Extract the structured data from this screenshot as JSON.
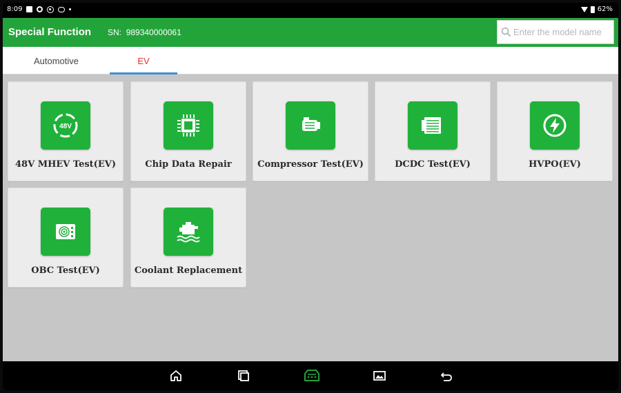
{
  "status_bar": {
    "time": "8:09",
    "battery": "62%"
  },
  "header": {
    "title": "Special Function",
    "sn_label": "SN:",
    "sn_value": "989340000061",
    "search_placeholder": "Enter the model name"
  },
  "tabs": [
    {
      "label": "Automotive",
      "active": false
    },
    {
      "label": "EV",
      "active": true
    }
  ],
  "functions": [
    {
      "label": "48V MHEV Test(EV)",
      "icon": "48v-icon"
    },
    {
      "label": "Chip Data Repair",
      "icon": "chip-icon"
    },
    {
      "label": "Compressor Test(EV)",
      "icon": "compressor-icon"
    },
    {
      "label": "DCDC Test(EV)",
      "icon": "dcdc-icon"
    },
    {
      "label": "HVPO(EV)",
      "icon": "hvpo-icon"
    },
    {
      "label": "OBC Test(EV)",
      "icon": "obc-icon"
    },
    {
      "label": "Coolant Replacement",
      "icon": "coolant-icon"
    }
  ],
  "icon_text": {
    "v48": "48V"
  },
  "colors": {
    "brand_green": "#23a43a",
    "tile_green": "#20b13b",
    "active_tab_text": "#e0322a",
    "active_tab_underline": "#3b8fd8"
  },
  "nav": [
    "home-icon",
    "recent-apps-icon",
    "vci-icon",
    "gallery-icon",
    "back-icon"
  ]
}
